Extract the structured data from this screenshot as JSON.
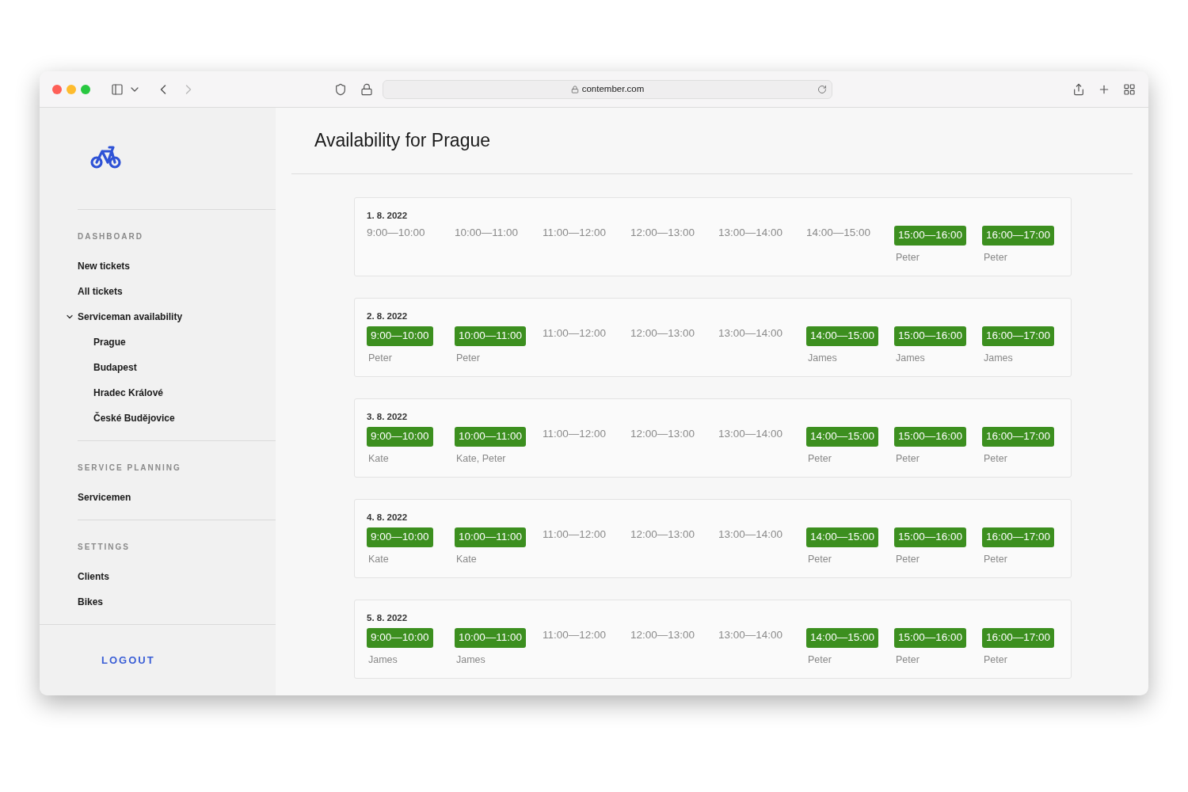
{
  "browser": {
    "address": "contember.com"
  },
  "sidebar": {
    "sections": [
      {
        "heading": "DASHBOARD",
        "items": [
          {
            "label": "New tickets"
          },
          {
            "label": "All tickets"
          },
          {
            "label": "Serviceman availability",
            "expanded": true,
            "children": [
              {
                "label": "Prague"
              },
              {
                "label": "Budapest"
              },
              {
                "label": "Hradec Králové"
              },
              {
                "label": "České Budějovice"
              }
            ]
          }
        ]
      },
      {
        "heading": "SERVICE PLANNING",
        "items": [
          {
            "label": "Servicemen"
          }
        ]
      },
      {
        "heading": "SETTINGS",
        "items": [
          {
            "label": "Clients"
          },
          {
            "label": "Bikes"
          }
        ]
      }
    ],
    "logout": "LOGOUT"
  },
  "page": {
    "title": "Availability for Prague"
  },
  "days": [
    {
      "date": "1. 8. 2022",
      "slots": [
        {
          "time": "9:00—10:00",
          "booked": false
        },
        {
          "time": "10:00—11:00",
          "booked": false
        },
        {
          "time": "11:00—12:00",
          "booked": false
        },
        {
          "time": "12:00—13:00",
          "booked": false
        },
        {
          "time": "13:00—14:00",
          "booked": false
        },
        {
          "time": "14:00—15:00",
          "booked": false
        },
        {
          "time": "15:00—16:00",
          "booked": true,
          "people": "Peter"
        },
        {
          "time": "16:00—17:00",
          "booked": true,
          "people": "Peter"
        }
      ]
    },
    {
      "date": "2. 8. 2022",
      "slots": [
        {
          "time": "9:00—10:00",
          "booked": true,
          "people": "Peter"
        },
        {
          "time": "10:00—11:00",
          "booked": true,
          "people": "Peter"
        },
        {
          "time": "11:00—12:00",
          "booked": false
        },
        {
          "time": "12:00—13:00",
          "booked": false
        },
        {
          "time": "13:00—14:00",
          "booked": false
        },
        {
          "time": "14:00—15:00",
          "booked": true,
          "people": "James"
        },
        {
          "time": "15:00—16:00",
          "booked": true,
          "people": "James"
        },
        {
          "time": "16:00—17:00",
          "booked": true,
          "people": "James"
        }
      ]
    },
    {
      "date": "3. 8. 2022",
      "slots": [
        {
          "time": "9:00—10:00",
          "booked": true,
          "people": "Kate"
        },
        {
          "time": "10:00—11:00",
          "booked": true,
          "people": "Kate, Peter"
        },
        {
          "time": "11:00—12:00",
          "booked": false
        },
        {
          "time": "12:00—13:00",
          "booked": false
        },
        {
          "time": "13:00—14:00",
          "booked": false
        },
        {
          "time": "14:00—15:00",
          "booked": true,
          "people": "Peter"
        },
        {
          "time": "15:00—16:00",
          "booked": true,
          "people": "Peter"
        },
        {
          "time": "16:00—17:00",
          "booked": true,
          "people": "Peter"
        }
      ]
    },
    {
      "date": "4. 8. 2022",
      "slots": [
        {
          "time": "9:00—10:00",
          "booked": true,
          "people": "Kate"
        },
        {
          "time": "10:00—11:00",
          "booked": true,
          "people": "Kate"
        },
        {
          "time": "11:00—12:00",
          "booked": false
        },
        {
          "time": "12:00—13:00",
          "booked": false
        },
        {
          "time": "13:00—14:00",
          "booked": false
        },
        {
          "time": "14:00—15:00",
          "booked": true,
          "people": "Peter"
        },
        {
          "time": "15:00—16:00",
          "booked": true,
          "people": "Peter"
        },
        {
          "time": "16:00—17:00",
          "booked": true,
          "people": "Peter"
        }
      ]
    },
    {
      "date": "5. 8. 2022",
      "slots": [
        {
          "time": "9:00—10:00",
          "booked": true,
          "people": "James"
        },
        {
          "time": "10:00—11:00",
          "booked": true,
          "people": "James"
        },
        {
          "time": "11:00—12:00",
          "booked": false
        },
        {
          "time": "12:00—13:00",
          "booked": false
        },
        {
          "time": "13:00—14:00",
          "booked": false
        },
        {
          "time": "14:00—15:00",
          "booked": true,
          "people": "Peter"
        },
        {
          "time": "15:00—16:00",
          "booked": true,
          "people": "Peter"
        },
        {
          "time": "16:00—17:00",
          "booked": true,
          "people": "Peter"
        }
      ]
    }
  ]
}
